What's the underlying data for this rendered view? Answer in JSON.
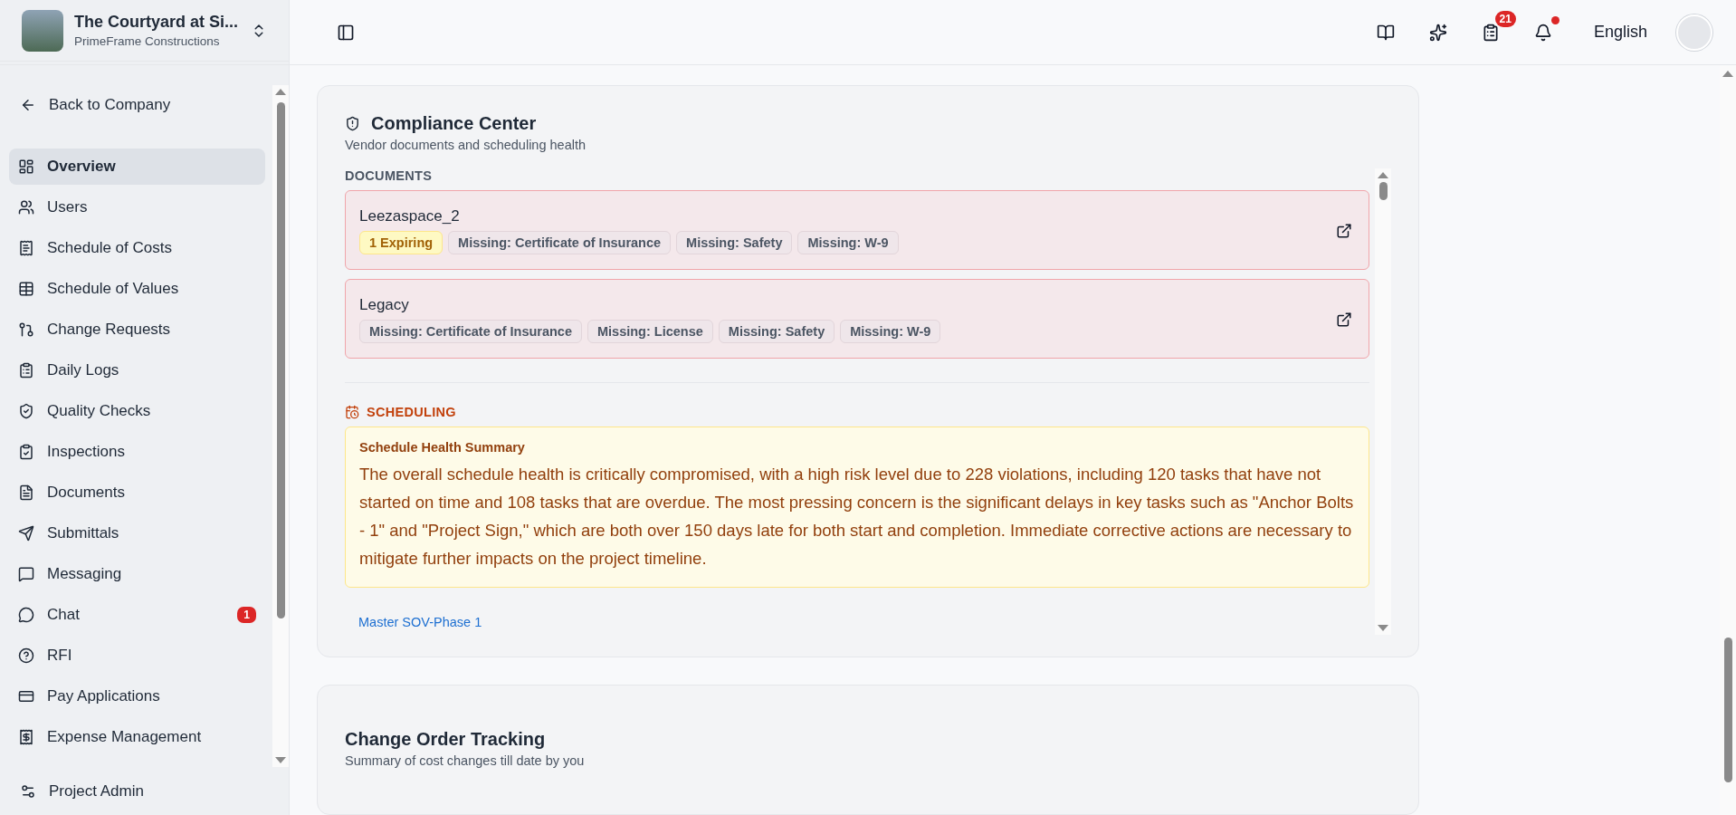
{
  "project": {
    "name": "The Courtyard at Si...",
    "company": "PrimeFrame Constructions"
  },
  "sidebar": {
    "back": "Back to Company",
    "items": [
      {
        "label": "Overview",
        "selected": true
      },
      {
        "label": "Users",
        "selected": false
      },
      {
        "label": "Schedule of Costs",
        "selected": false
      },
      {
        "label": "Schedule of Values",
        "selected": false
      },
      {
        "label": "Change Requests",
        "selected": false
      },
      {
        "label": "Daily Logs",
        "selected": false
      },
      {
        "label": "Quality Checks",
        "selected": false
      },
      {
        "label": "Inspections",
        "selected": false
      },
      {
        "label": "Documents",
        "selected": false
      },
      {
        "label": "Submittals",
        "selected": false
      },
      {
        "label": "Messaging",
        "selected": false
      },
      {
        "label": "Chat",
        "selected": false,
        "badge": "1"
      },
      {
        "label": "RFI",
        "selected": false
      },
      {
        "label": "Pay Applications",
        "selected": false
      },
      {
        "label": "Expense Management",
        "selected": false
      }
    ],
    "footer": "Project Admin"
  },
  "topbar": {
    "tasks_badge": "21",
    "notifications_unread": true,
    "language": "English"
  },
  "compliance": {
    "title": "Compliance Center",
    "subtitle": "Vendor documents and scheduling health",
    "documents_heading": "DOCUMENTS",
    "vendors": [
      {
        "name": "Leezaspace_2",
        "tags": [
          {
            "kind": "warning",
            "text": "1 Expiring"
          },
          {
            "kind": "missing",
            "text": "Missing: Certificate of Insurance"
          },
          {
            "kind": "missing",
            "text": "Missing: Safety"
          },
          {
            "kind": "missing",
            "text": "Missing: W-9"
          }
        ]
      },
      {
        "name": "Legacy",
        "tags": [
          {
            "kind": "missing",
            "text": "Missing: Certificate of Insurance"
          },
          {
            "kind": "missing",
            "text": "Missing: License"
          },
          {
            "kind": "missing",
            "text": "Missing: Safety"
          },
          {
            "kind": "missing",
            "text": "Missing: W-9"
          }
        ]
      }
    ],
    "scheduling_heading": "SCHEDULING",
    "summary": {
      "title": "Schedule Health Summary",
      "text": "The overall schedule health is critically compromised, with a high risk level due to 228 violations, including 120 tasks that have not started on time and 108 tasks that are overdue. The most pressing concern is the significant delays in key tasks such as \"Anchor Bolts - 1\" and \"Project Sign,\" which are both over 150 days late for both start and completion. Immediate corrective actions are necessary to mitigate further impacts on the project timeline."
    },
    "link": "Master SOV-Phase 1"
  },
  "change_orders": {
    "title": "Change Order Tracking",
    "subtitle": "Summary of cost changes till date by you"
  }
}
